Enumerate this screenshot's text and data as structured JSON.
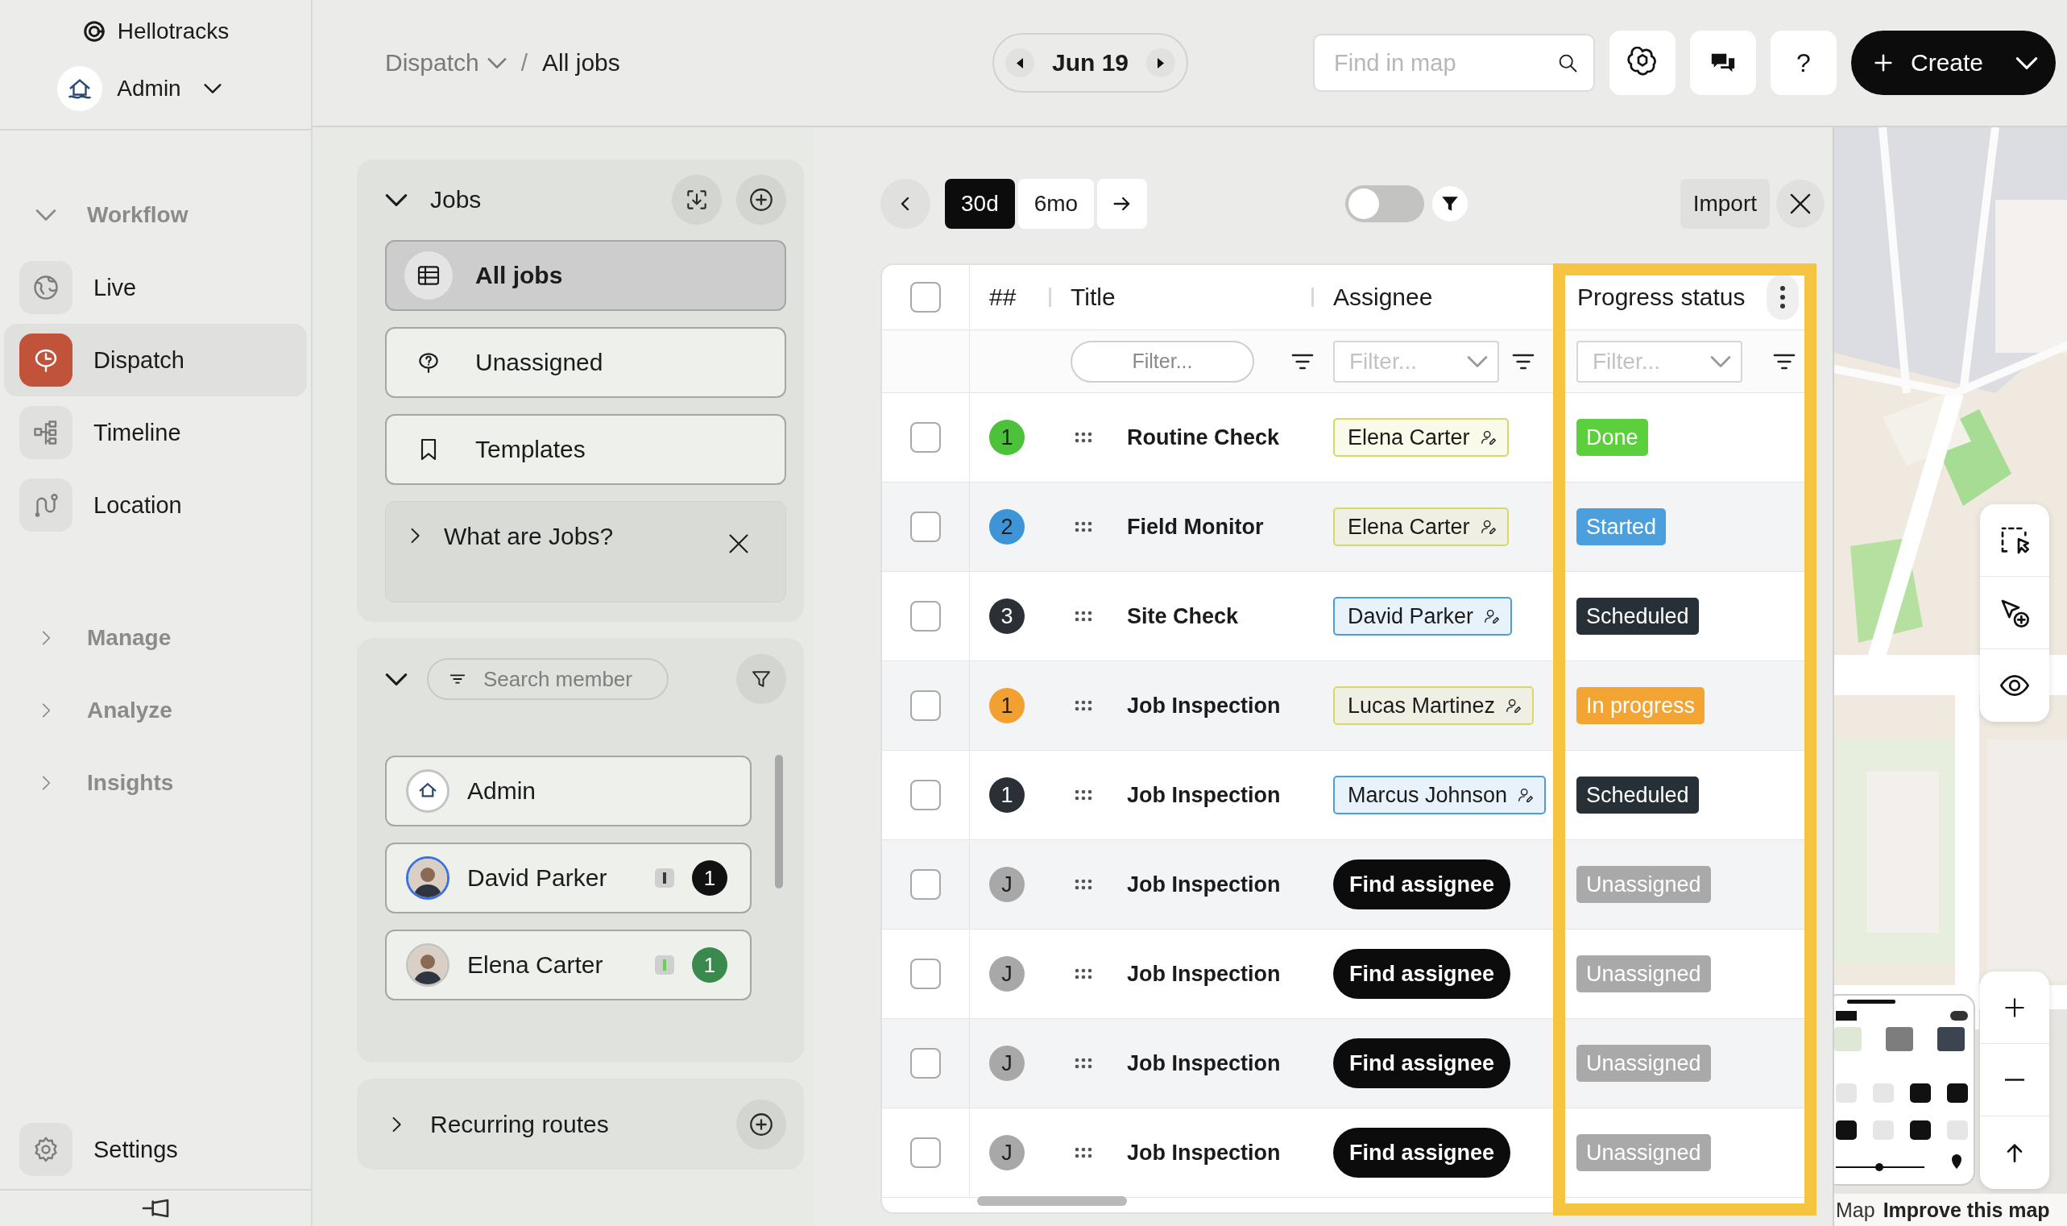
{
  "sidebar": {
    "brand": "Hellotracks",
    "account": "Admin",
    "sections": [
      {
        "label": "Workflow",
        "expanded": true,
        "items": [
          {
            "label": "Live",
            "selected": false
          },
          {
            "label": "Dispatch",
            "selected": true
          },
          {
            "label": "Timeline",
            "selected": false
          },
          {
            "label": "Location",
            "selected": false
          }
        ]
      },
      {
        "label": "Manage",
        "expanded": false
      },
      {
        "label": "Analyze",
        "expanded": false
      },
      {
        "label": "Insights",
        "expanded": false
      }
    ],
    "settings": "Settings"
  },
  "header": {
    "breadcrumb": [
      {
        "label": "Dispatch",
        "dropdown": true
      },
      {
        "label": "All jobs",
        "dropdown": false
      }
    ],
    "separator": "/",
    "date": "Jun 19",
    "search": {
      "placeholder": "Find in map"
    },
    "help": "?",
    "create": "Create"
  },
  "jobs_panel": {
    "title": "Jobs",
    "expanded": true,
    "views": [
      {
        "label": "All jobs",
        "selected": true
      },
      {
        "label": "Unassigned",
        "selected": false
      },
      {
        "label": "Templates",
        "selected": false
      }
    ],
    "info": {
      "label": "What are Jobs?",
      "expanded": false
    }
  },
  "members_panel": {
    "expanded": true,
    "search": {
      "placeholder": "Search member"
    },
    "members": [
      {
        "name": "Admin",
        "kind": "logo",
        "online": false
      },
      {
        "name": "David Parker",
        "kind": "person",
        "online": true,
        "indicator": {
          "color": "#3a3a3a"
        },
        "badge": {
          "text": "1",
          "color": "#111111"
        }
      },
      {
        "name": "Elena Carter",
        "kind": "person",
        "online": false,
        "indicator": {
          "color": "#62d450"
        },
        "badge": {
          "text": "1",
          "color": "#3a8a4e"
        }
      }
    ]
  },
  "routes_panel": {
    "title": "Recurring routes",
    "expanded": false
  },
  "toolbar": {
    "ranges": [
      {
        "label": "30d",
        "selected": true
      },
      {
        "label": "6mo",
        "selected": false
      }
    ],
    "toggle": {
      "on": false
    },
    "import": "Import"
  },
  "table": {
    "all_checked": false,
    "columns": [
      {
        "label": "##",
        "highlighted": false
      },
      {
        "label": "Title",
        "highlighted": false,
        "filter": {
          "kind": "pill",
          "placeholder": "Filter..."
        }
      },
      {
        "label": "Assignee",
        "highlighted": false,
        "filter": {
          "kind": "select",
          "placeholder": "Filter..."
        }
      },
      {
        "label": "Progress status",
        "highlighted": true,
        "filter": {
          "kind": "select",
          "placeholder": "Filter..."
        }
      }
    ],
    "rows": [
      {
        "checked": false,
        "number": "1",
        "color": "#4cc13a",
        "title": "Routine Check",
        "assignee": {
          "kind": "member",
          "name": "Elena Carter",
          "color": "#d6d96a"
        },
        "status": {
          "label": "Done",
          "color": "#5ccf3c"
        }
      },
      {
        "checked": false,
        "number": "2",
        "color": "#3d95d8",
        "title": "Field Monitor",
        "assignee": {
          "kind": "member",
          "name": "Elena Carter",
          "color": "#d6d96a"
        },
        "status": {
          "label": "Started",
          "color": "#4a9fdc"
        }
      },
      {
        "checked": false,
        "number": "3",
        "color": "#2a3036",
        "title": "Site Check",
        "assignee": {
          "kind": "member",
          "name": "David Parker",
          "color": "#4a9de0"
        },
        "status": {
          "label": "Scheduled",
          "color": "#263036"
        }
      },
      {
        "checked": false,
        "number": "1",
        "color": "#f3a033",
        "title": "Job Inspection",
        "assignee": {
          "kind": "member",
          "name": "Lucas Martinez",
          "color": "#d6d96a"
        },
        "status": {
          "label": "In progress",
          "color": "#f4a432"
        }
      },
      {
        "checked": false,
        "number": "1",
        "color": "#2a3036",
        "title": "Job Inspection",
        "assignee": {
          "kind": "member",
          "name": "Marcus Johnson",
          "color": "#4a9de0"
        },
        "status": {
          "label": "Scheduled",
          "color": "#263036"
        }
      },
      {
        "checked": false,
        "number": "J",
        "color": "#a8a8a8",
        "title": "Job Inspection",
        "assignee": {
          "kind": "button",
          "name": "Find assignee"
        },
        "status": {
          "label": "Unassigned",
          "color": "#a9a9a9"
        }
      },
      {
        "checked": false,
        "number": "J",
        "color": "#a8a8a8",
        "title": "Job Inspection",
        "assignee": {
          "kind": "button",
          "name": "Find assignee"
        },
        "status": {
          "label": "Unassigned",
          "color": "#a9a9a9"
        }
      },
      {
        "checked": false,
        "number": "J",
        "color": "#a8a8a8",
        "title": "Job Inspection",
        "assignee": {
          "kind": "button",
          "name": "Find assignee"
        },
        "status": {
          "label": "Unassigned",
          "color": "#a9a9a9"
        }
      },
      {
        "checked": false,
        "number": "J",
        "color": "#a8a8a8",
        "title": "Job Inspection",
        "assignee": {
          "kind": "button",
          "name": "Find assignee"
        },
        "status": {
          "label": "Unassigned",
          "color": "#a9a9a9"
        }
      }
    ]
  },
  "map": {
    "attribution": [
      "Map",
      "Improve this map"
    ]
  }
}
